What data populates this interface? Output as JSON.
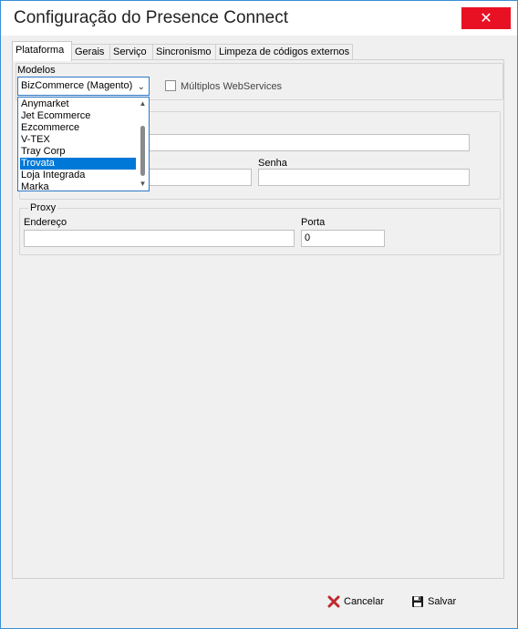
{
  "window": {
    "title": "Configuração do Presence Connect",
    "close_symbol": "✕"
  },
  "tabs": [
    {
      "label": "Plataforma"
    },
    {
      "label": "Gerais"
    },
    {
      "label": "Serviço"
    },
    {
      "label": "Sincronismo"
    },
    {
      "label": "Limpeza de códigos externos"
    }
  ],
  "modelos": {
    "label": "Modelos",
    "selected": "BizCommerce (Magento)",
    "multiple_webservices_label": "Múltiplos WebServices",
    "options": [
      "Anymarket",
      "Jet Ecommerce",
      "Ezcommerce",
      "V-TEX",
      "Tray Corp",
      "Trovata",
      "Loja Integrada",
      "Marka"
    ],
    "highlighted": "Trovata"
  },
  "credentials": {
    "senha_label": "Senha"
  },
  "proxy": {
    "legend": "Proxy",
    "endereco_label": "Endereço",
    "porta_label": "Porta",
    "porta_value": "0"
  },
  "buttons": {
    "cancel_label": "Cancelar",
    "save_label": "Salvar"
  },
  "colors": {
    "accent": "#0078d7",
    "close": "#e81123",
    "cancel_icon": "#c0282d"
  }
}
